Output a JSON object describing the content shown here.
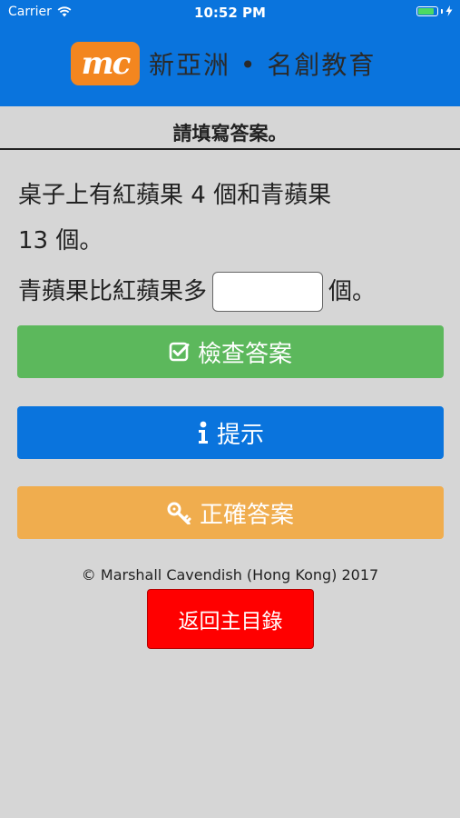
{
  "status_bar": {
    "carrier": "Carrier",
    "time": "10:52 PM"
  },
  "header": {
    "logo_mark": "mc",
    "logo_text": "新亞洲 • 名創教育",
    "background_color": "#0a74dd",
    "logo_color": "#f3861f"
  },
  "instruction": "請填寫答案。",
  "question": {
    "line1": "桌子上有紅蘋果 4 個和青蘋果",
    "line2": "13 個。",
    "prefix": "青蘋果比紅蘋果多",
    "suffix": "個。",
    "answer_value": ""
  },
  "buttons": {
    "check": {
      "label": "檢查答案",
      "icon": "check-square-icon",
      "color": "#5cb85c"
    },
    "hint": {
      "label": "提示",
      "icon": "info-icon",
      "color": "#0a74dd"
    },
    "answer": {
      "label": "正確答案",
      "icon": "key-icon",
      "color": "#f0ad4e"
    }
  },
  "copyright": "© Marshall Cavendish (Hong Kong) 2017",
  "back_button": {
    "label": "返回主目錄",
    "color": "#ff0000"
  }
}
